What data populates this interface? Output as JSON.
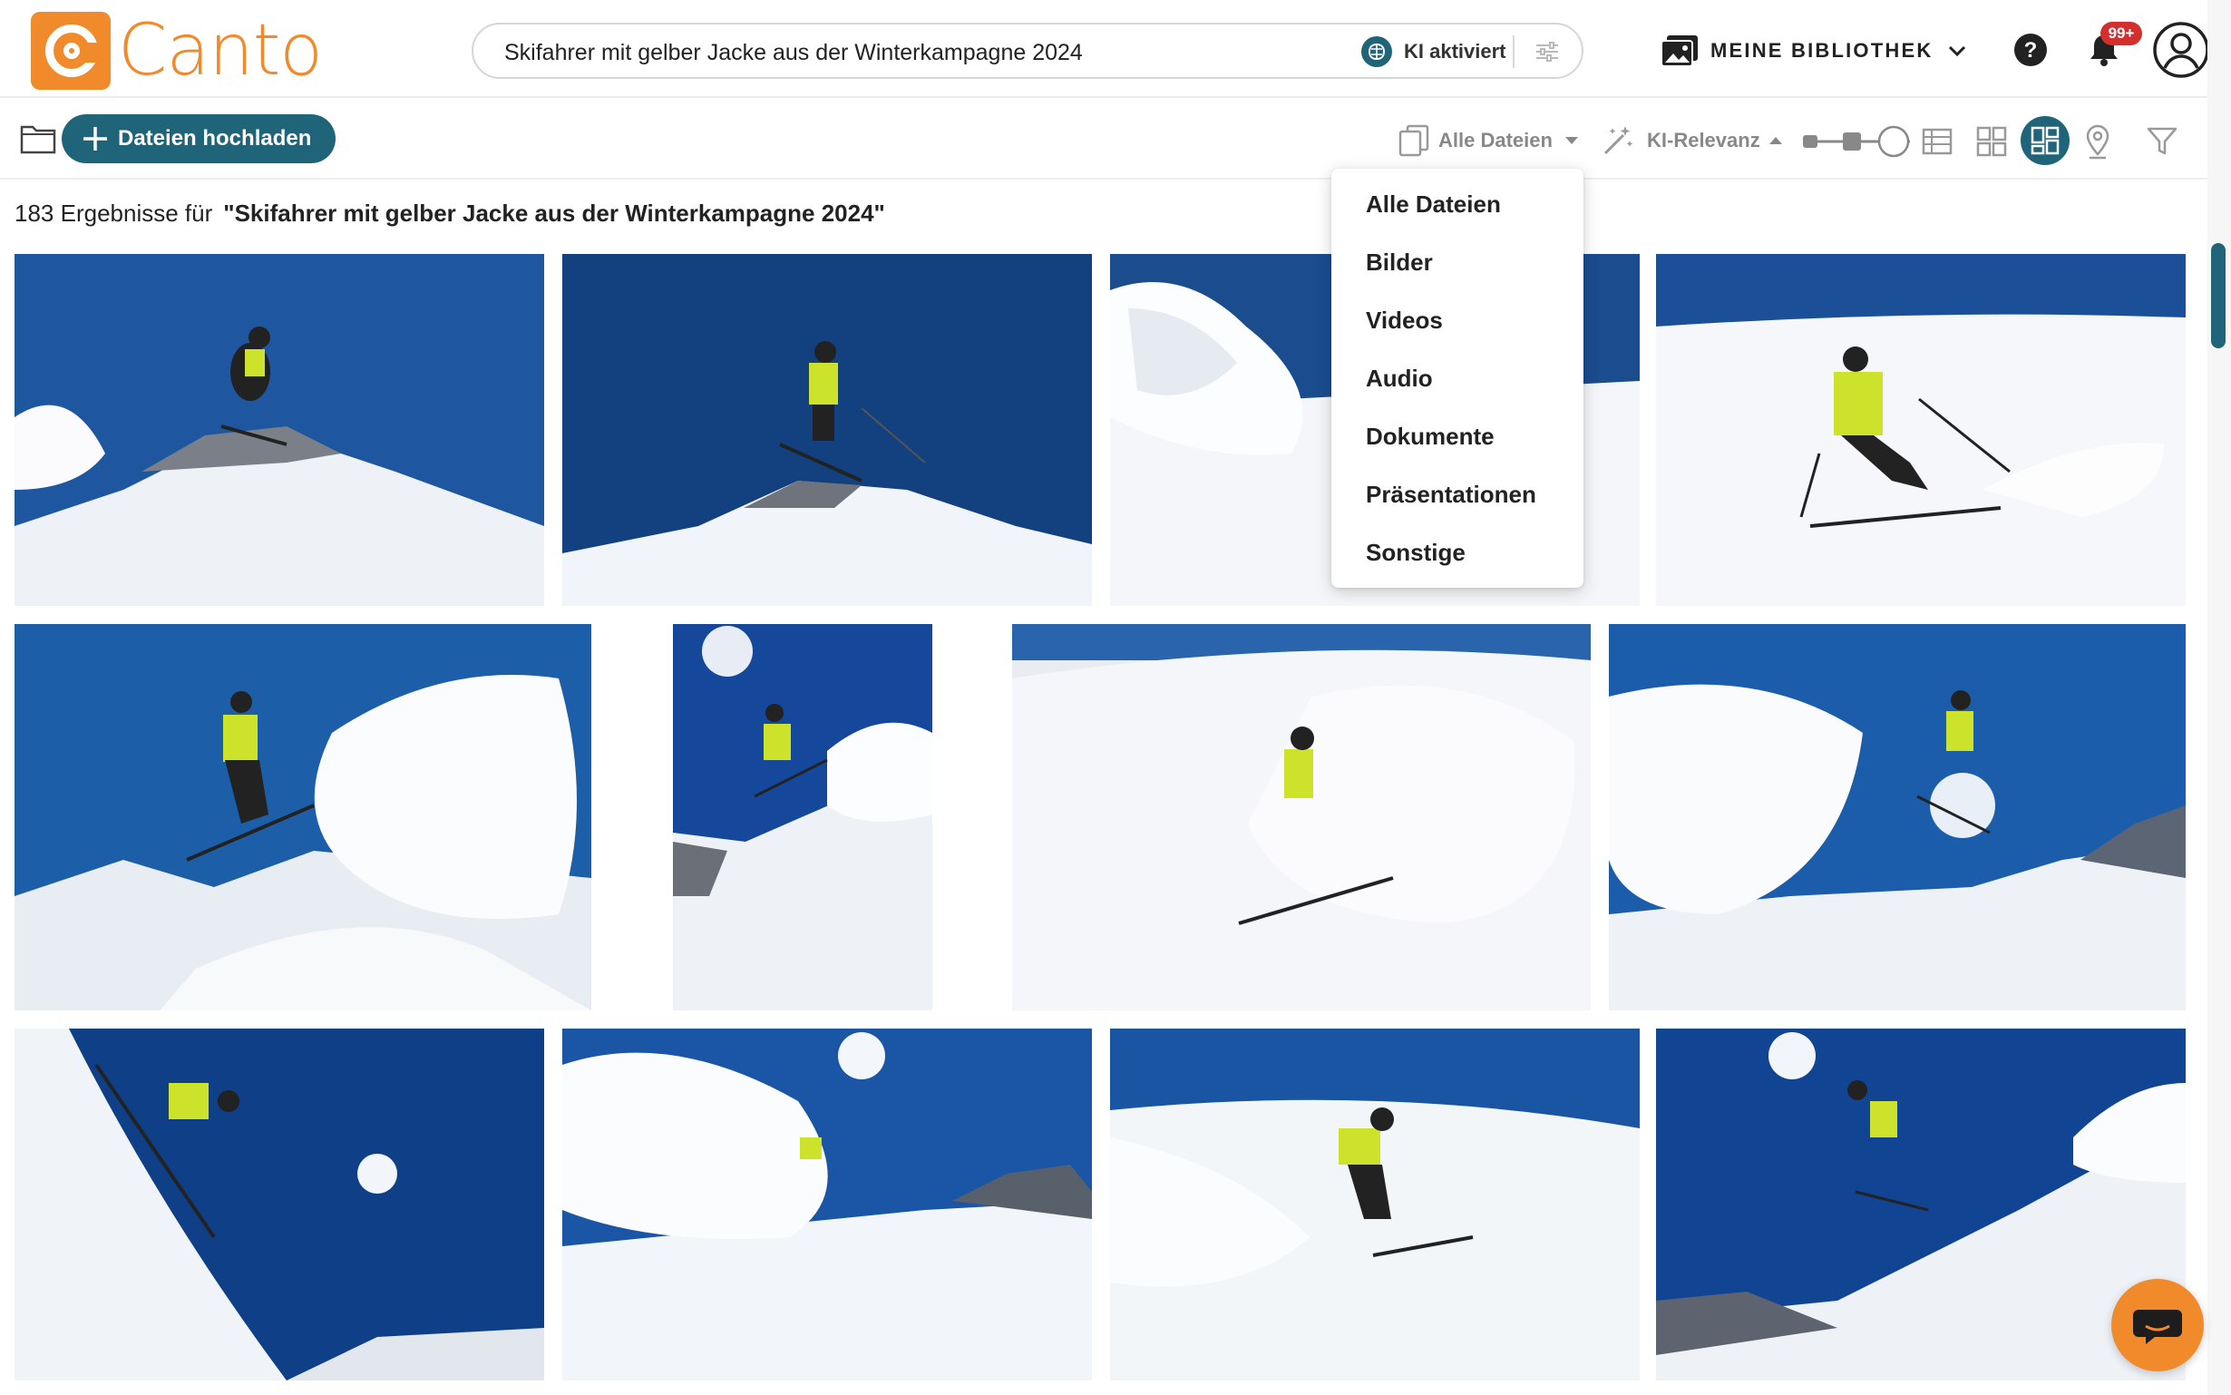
{
  "app": {
    "logo_text": "Canto",
    "brand_color": "#f08a2b",
    "accent_color": "#1f6479"
  },
  "search": {
    "query": "Skifahrer mit gelber Jacke aus der Winterkampagne 2024",
    "ai_label": "KI aktiviert",
    "ai_icon": "brain-icon",
    "settings_icon": "sliders-icon"
  },
  "header": {
    "library_label": "MEINE BIBLIOTHEK",
    "library_icon": "photo-library-icon",
    "help_icon": "help-icon",
    "notifications_icon": "bell-icon",
    "notification_badge": "99+",
    "avatar_icon": "user-avatar-icon"
  },
  "toolbar": {
    "upload_label": "Dateien hochladen",
    "type_filter_label": "Alle Dateien",
    "sort_label": "KI-Relevanz",
    "active_view": "masonry"
  },
  "results": {
    "count_text": "183 Ergebnisse für",
    "query_quoted": "\"Skifahrer mit gelber Jacke aus der Winterkampagne 2024\""
  },
  "type_dropdown": {
    "options": [
      "Alle Dateien",
      "Bilder",
      "Videos",
      "Audio",
      "Dokumente",
      "Präsentationen",
      "Sonstige"
    ]
  },
  "images": [
    {
      "name": "skier-jumping-rocky-ridge",
      "sky": "#1e56a0"
    },
    {
      "name": "skier-jumping-peak",
      "sky": "#13417f"
    },
    {
      "name": "powder-spray-slope",
      "sky": "#1a4c8e"
    },
    {
      "name": "skier-carving-slope",
      "sky": "#f2f4f7"
    },
    {
      "name": "skier-jumping-powder-cloud",
      "sky": "#1c5fa8"
    },
    {
      "name": "skier-jump-sun-vertical",
      "sky": "#15489a"
    },
    {
      "name": "skier-powder-turn",
      "sky": "#e9edf2"
    },
    {
      "name": "skier-jumping-snowy-tree",
      "sky": "#1b5cab"
    },
    {
      "name": "skier-steep-descent-sun",
      "sky": "#0f3f86"
    },
    {
      "name": "skier-powder-burst-sun",
      "sky": "#1a56a5"
    },
    {
      "name": "skier-deep-powder",
      "sky": "#1a55a3"
    },
    {
      "name": "skier-jump-sun-slope",
      "sky": "#124494"
    }
  ]
}
